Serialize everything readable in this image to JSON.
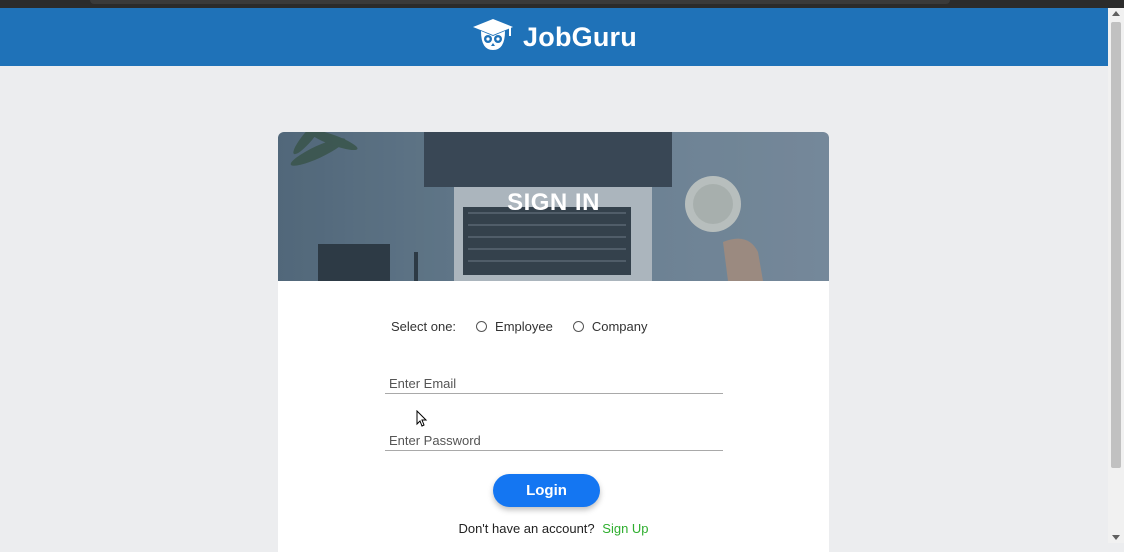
{
  "header": {
    "brand_title": "JobGuru",
    "logo_icon": "owl-graduation-cap-icon"
  },
  "card": {
    "banner_title": "SIGN IN",
    "select_label": "Select one:",
    "role_options": [
      "Employee",
      "Company"
    ],
    "email_placeholder": "Enter Email",
    "password_placeholder": "Enter Password",
    "login_label": "Login",
    "signup_prompt": "Don't have an account?",
    "signup_link": "Sign Up"
  },
  "colors": {
    "header_bg": "#1f72b8",
    "login_button": "#1476f2",
    "signup_link": "#2eae2e"
  }
}
